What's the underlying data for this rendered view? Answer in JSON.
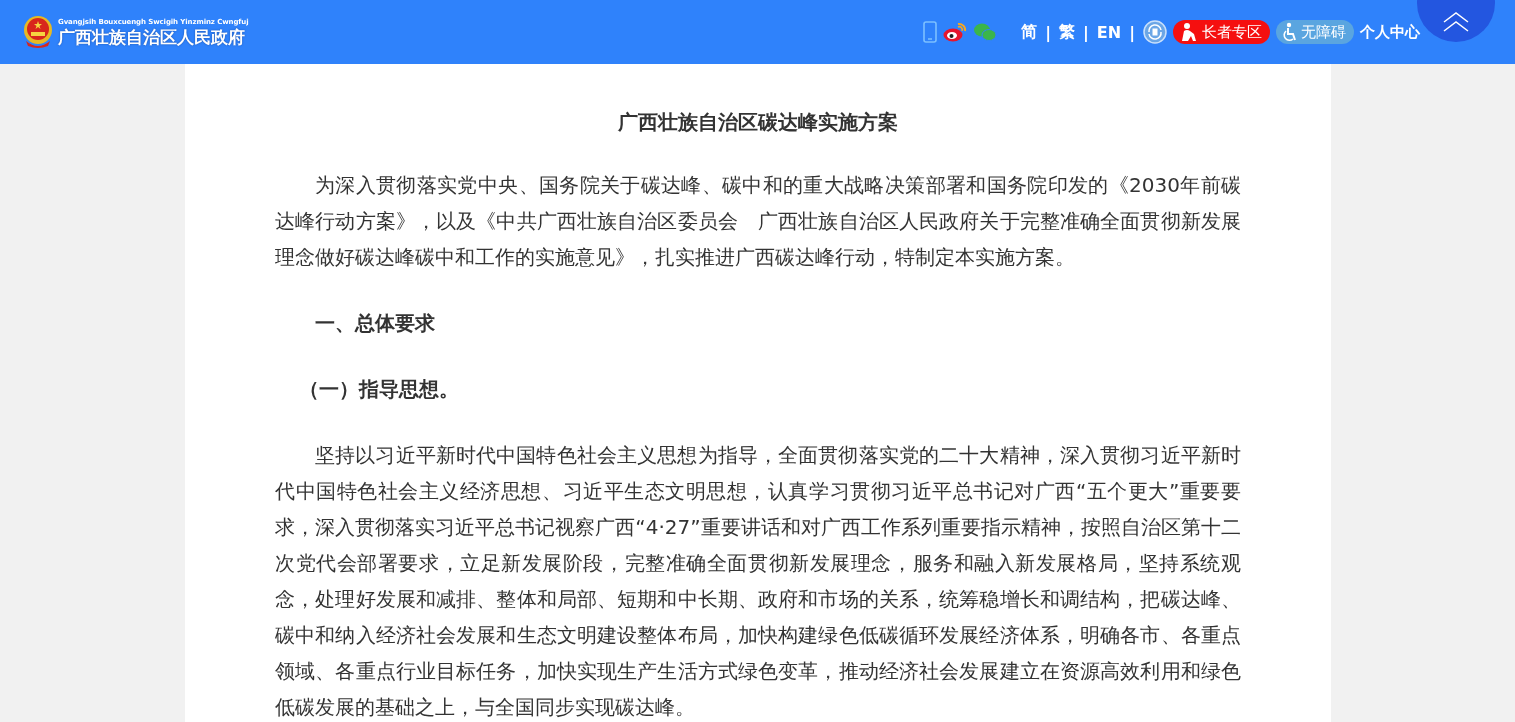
{
  "header": {
    "logo_subtitle": "Gvangjsih Bouxcuengh Swcigih Yinzminz Cwngfuj",
    "logo_title": "广西壮族自治区人民政府",
    "lang_items": [
      {
        "kind": "link",
        "text": "简"
      },
      {
        "kind": "separator",
        "text": "|"
      },
      {
        "kind": "link",
        "text": "繁"
      },
      {
        "kind": "separator",
        "text": "|"
      },
      {
        "kind": "link",
        "text": "EN"
      },
      {
        "kind": "separator",
        "text": "|"
      }
    ],
    "elder_button": "长者专区",
    "accessible_button": "无障碍",
    "user_center": "个人中心"
  },
  "article": {
    "title": "广西壮族自治区碳达峰实施方案",
    "blocks": [
      {
        "kind": "paragraph",
        "text": "为深入贯彻落实党中央、国务院关于碳达峰、碳中和的重大战略决策部署和国务院印发的《2030年前碳达峰行动方案》，以及《中共广西壮族自治区委员会　广西壮族自治区人民政府关于完整准确全面贯彻新发展理念做好碳达峰碳中和工作的实施意见》，扎实推进广西碳达峰行动，特制定本实施方案。"
      },
      {
        "kind": "heading",
        "text": "一、总体要求"
      },
      {
        "kind": "subheading",
        "text": "（一）指导思想。"
      },
      {
        "kind": "paragraph",
        "text": "坚持以习近平新时代中国特色社会主义思想为指导，全面贯彻落实党的二十大精神，深入贯彻习近平新时代中国特色社会主义经济思想、习近平生态文明思想，认真学习贯彻习近平总书记对广西“五个更大”重要要求，深入贯彻落实习近平总书记视察广西“4·27”重要讲话和对广西工作系列重要指示精神，按照自治区第十二次党代会部署要求，立足新发展阶段，完整准确全面贯彻新发展理念，服务和融入新发展格局，坚持系统观念，处理好发展和减排、整体和局部、短期和中长期、政府和市场的关系，统筹稳增长和调结构，把碳达峰、碳中和纳入经济社会发展和生态文明建设整体布局，加快构建绿色低碳循环发展经济体系，明确各市、各重点领域、各重点行业目标任务，加快实现生产生活方式绿色变革，推动经济社会发展建立在资源高效利用和绿色低碳发展的基础之上，与全国同步实现碳达峰。"
      }
    ]
  }
}
